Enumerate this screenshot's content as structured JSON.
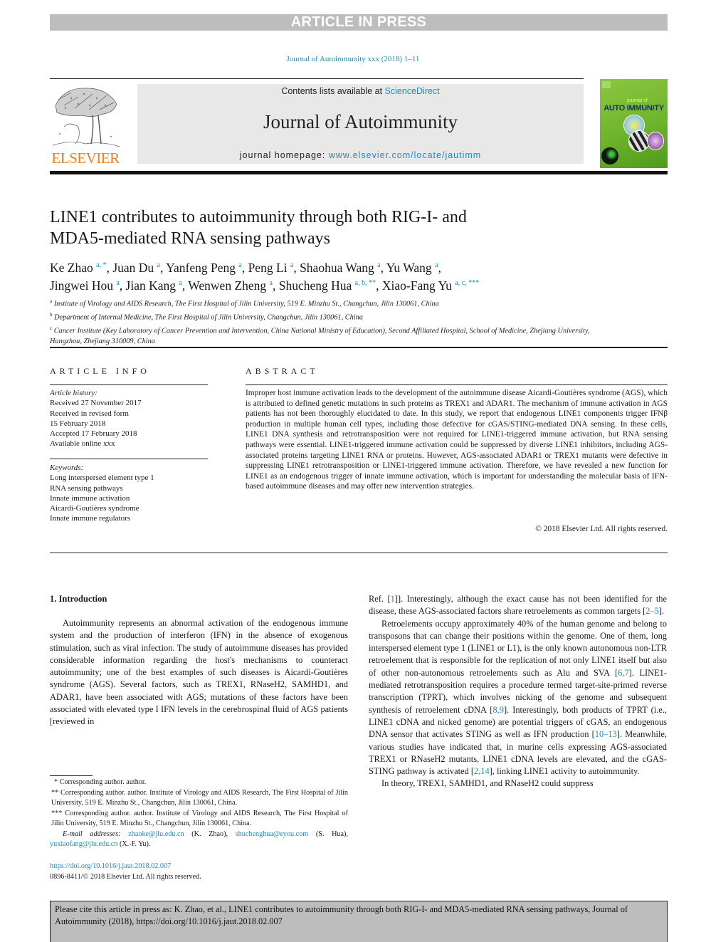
{
  "banner": {
    "text": "ARTICLE IN PRESS"
  },
  "journal_ref": "Journal of Autoimmunity xxx (2018) 1–11",
  "header": {
    "publisher_word": "ELSEVIER",
    "contents_prefix": "Contents lists available at ",
    "contents_link": "ScienceDirect",
    "journal_name": "Journal of Autoimmunity",
    "homepage_prefix": "journal homepage: ",
    "homepage_link": "www.elsevier.com/locate/jautimm",
    "cover": {
      "small_label": "journal of",
      "title": "AUTO IMMUNITY"
    }
  },
  "colors": {
    "link": "#1f8bbf",
    "banner": "#bdbdbd",
    "elsevier_orange": "#f07f1c",
    "cover_green": "#8cc63f"
  },
  "article": {
    "title_line1": "LINE1 contributes to autoimmunity through both RIG-I- and",
    "title_line2": "MDA5-mediated RNA sensing pathways",
    "authors": [
      {
        "name": "Ke Zhao",
        "sup": "a, *"
      },
      {
        "name": "Juan Du",
        "sup": "a"
      },
      {
        "name": "Yanfeng Peng",
        "sup": "a"
      },
      {
        "name": "Peng Li",
        "sup": "a"
      },
      {
        "name": "Shaohua Wang",
        "sup": "a"
      },
      {
        "name": "Yu Wang",
        "sup": "a"
      },
      {
        "name": "Jingwei Hou",
        "sup": "a"
      },
      {
        "name": "Jian Kang",
        "sup": "a"
      },
      {
        "name": "Wenwen Zheng",
        "sup": "a"
      },
      {
        "name": "Shucheng Hua",
        "sup": "a, b, **"
      },
      {
        "name": "Xiao-Fang Yu",
        "sup": "a, c, ***"
      }
    ],
    "affiliations": [
      {
        "key": "a",
        "text": "Institute of Virology and AIDS Research, The First Hospital of Jilin University, 519 E. Minzhu St., Changchun, Jilin 130061, China"
      },
      {
        "key": "b",
        "text": "Department of Internal Medicine, The First Hospital of Jilin University, Changchun, Jilin 130061, China"
      },
      {
        "key": "c",
        "text": "Cancer Institute (Key Laboratory of Cancer Prevention and Intervention, China National Ministry of Education), Second Affiliated Hospital, School of Medicine, Zhejiang University, Hangzhou, Zhejiang 310009, China"
      }
    ]
  },
  "article_info": {
    "heading": "ARTICLE INFO",
    "history_label": "Article history:",
    "history": [
      "Received 27 November 2017",
      "Received in revised form",
      "15 February 2018",
      "Accepted 17 February 2018",
      "Available online xxx"
    ],
    "keywords_label": "Keywords:",
    "keywords": [
      "Long interspersed element type 1",
      "RNA sensing pathways",
      "Innate immune activation",
      "Aicardi-Goutières syndrome",
      "Innate immune regulators"
    ]
  },
  "abstract": {
    "heading": "ABSTRACT",
    "text": "Improper host immune activation leads to the development of the autoimmune disease Aicardi-Goutières syndrome (AGS), which is attributed to defined genetic mutations in such proteins as TREX1 and ADAR1. The mechanism of immune activation in AGS patients has not been thoroughly elucidated to date. In this study, we report that endogenous LINE1 components trigger IFNβ production in multiple human cell types, including those defective for cGAS/STING-mediated DNA sensing. In these cells, LINE1 DNA synthesis and retrotransposition were not required for LINE1-triggered immune activation, but RNA sensing pathways were essential. LINE1-triggered immune activation could be suppressed by diverse LINE1 inhibitors, including AGS-associated proteins targeting LINE1 RNA or proteins. However, AGS-associated ADAR1 or TREX1 mutants were defective in suppressing LINE1 retrotransposition or LINE1-triggered immune activation. Therefore, we have revealed a new function for LINE1 as an endogenous trigger of innate immune activation, which is important for understanding the molecular basis of IFN-based autoimmune diseases and may offer new intervention strategies.",
    "copyright": "© 2018 Elsevier Ltd. All rights reserved."
  },
  "body": {
    "section_heading": "1.  Introduction",
    "left_para1": "Autoimmunity represents an abnormal activation of the endogenous immune system and the production of interferon (IFN) in the absence of exogenous stimulation, such as viral infection. The study of autoimmune diseases has provided considerable information regarding the host's mechanisms to counteract autoimmunity; one of the best examples of such diseases is Aicardi-Goutières syndrome (AGS). Several factors, such as TREX1, RNaseH2, SAMHD1, and ADAR1, have been associated with AGS; mutations of these factors have been associated with elevated type I IFN levels in the cerebrospinal fluid of AGS patients [reviewed in",
    "right_cont_a": "Ref. [",
    "right_ref1": "1",
    "right_cont_b": "]]. Interestingly, although the exact cause has not been identified for the disease, these AGS-associated factors share retroelements as common targets [",
    "right_ref2": "2–5",
    "right_cont_c": "].",
    "right_para2_a": "Retroelements occupy approximately 40% of the human genome and belong to transposons that can change their positions within the genome. One of them, long interspersed element type 1 (LINE1 or L1), is the only known autonomous non-LTR retroelement that is responsible for the replication of not only LINE1 itself but also of other non-autonomous retroelements such as Alu and SVA [",
    "right_ref3": "6,7",
    "right_para2_b": "]. LINE1-mediated retrotransposition requires a procedure termed target-site-primed reverse transcription (TPRT), which involves nicking of the genome and subsequent synthesis of retroelement cDNA [",
    "right_ref4": "8,9",
    "right_para2_c": "]. Interestingly, both products of TPRT (i.e., LINE1 cDNA and nicked genome) are potential triggers of cGAS, an endogenous DNA sensor that activates STING as well as IFN production [",
    "right_ref5": "10–13",
    "right_para2_d": "]. Meanwhile, various studies have indicated that, in murine cells expressing AGS-associated TREX1 or RNaseH2 mutants, LINE1 cDNA levels are elevated, and the cGAS-STING pathway is activated [",
    "right_ref6": "2,14",
    "right_para2_e": "], linking LINE1 activity to autoimmunity.",
    "right_para3": "In theory, TREX1, SAMHD1, and RNaseH2 could suppress"
  },
  "footnotes": {
    "fn1": "* Corresponding author. author.",
    "fn2": "** Corresponding author. author. Institute of Virology and AIDS Research, The First Hospital of Jilin University, 519 E. Minzhu St., Changchun, Jilin 130061, China.",
    "fn3": "*** Corresponding author. author. Institute of Virology and AIDS Research, The First Hospital of Jilin University, 519 E. Minzhu St., Changchun, Jilin 130061, China.",
    "email_label": "E-mail addresses:",
    "emails": [
      {
        "address": "zhaoke@jlu.edu.cn",
        "who": " (K. Zhao), "
      },
      {
        "address": "shuchenghua@eyou.com",
        "who": " (S. Hua), "
      },
      {
        "address": "yuxiaofang@jlu.edu.cn",
        "who": " (X.-F. Yu)."
      }
    ],
    "doi": "https://doi.org/10.1016/j.jaut.2018.02.007",
    "issn": "0896-8411/© 2018 Elsevier Ltd. All rights reserved."
  },
  "citation_box": {
    "text": "Please cite this article in press as: K. Zhao, et al., LINE1 contributes to autoimmunity through both RIG-I- and MDA5-mediated RNA sensing pathways, Journal of Autoimmunity (2018), https://doi.org/10.1016/j.jaut.2018.02.007"
  }
}
